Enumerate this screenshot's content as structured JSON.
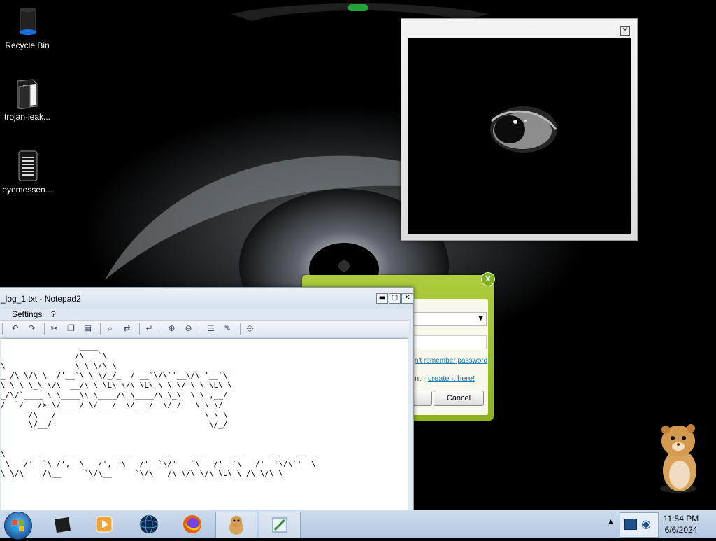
{
  "desktop": {
    "icons": [
      {
        "label": "Recycle Bin"
      },
      {
        "label": "trojan-leak..."
      },
      {
        "label": "eyemessen..."
      }
    ]
  },
  "viewer": {
    "close": "✕"
  },
  "login": {
    "close": "x",
    "forgot_password": "n't remember password",
    "no_account_prefix": "nt - ",
    "create_link": "create it here!",
    "cancel_label": "Cancel"
  },
  "notepad": {
    "title": "_log_1.txt - Notepad2",
    "menu": [
      "Settings",
      "?"
    ],
    "content": "                 ____\n                /\\  _`\\\n\\  __  __     __\\ \\ \\/\\_\\     ___    _ __     ____\n_ /\\ \\/\\ \\  /'__`\\ \\ \\/_/_  / __`\\/\\`'__\\/\\ '__`\\\n\\ \\ \\ \\_\\ \\/\\  __/\\ \\ \\L\\ \\/\\ \\L\\ \\ \\ \\/ \\ \\ \\L\\ \\\n_/\\/`____ \\ \\____\\\\ \\____/\\ \\____/\\ \\_\\  \\ \\ ,__/\n/  `/___/> \\/____/ \\/___/  \\/___/  \\/_/   \\ \\ \\/\n      /\\___/                                \\ \\_\\\n      \\/__/                                  \\/_/\n\n\n\\      __     ____      ____       __    ___      __      __    _ __\n \\   /'__`\\ /',__\\   /',__\\   /'__`\\/' _ `\\   /'__`\\   /'__`\\/\\`'__\\\n\\ \\/\\    /\\__     `\\/\\__     `\\/\\   /\\ \\/\\ \\/\\ \\L\\ \\ /\\ \\/\\ \\"
  },
  "taskbar": {
    "apps": [
      "terminal",
      "media-player",
      "globe",
      "firefox",
      "hamster-messenger",
      "notepad2"
    ],
    "active": [
      "hamster-messenger",
      "notepad2"
    ],
    "time": "11:54 PM",
    "date": "6/6/2024"
  },
  "colors": {
    "login_green": "#9cbf2a",
    "link_blue": "#1a7fb5",
    "taskbar": "#c2d3e8"
  }
}
